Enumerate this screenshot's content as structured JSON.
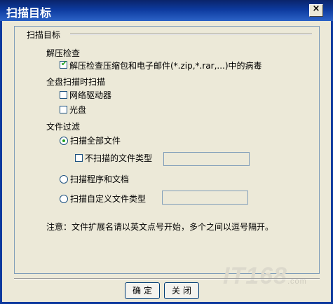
{
  "window": {
    "title": "扫描目标",
    "close_glyph": "×"
  },
  "group": {
    "title": "扫描目标"
  },
  "decompress": {
    "heading": "解压检查",
    "option_label": "解压检查压缩包和电子邮件(*.zip,*.rar,...)中的病毒",
    "checked": true
  },
  "full_scan": {
    "heading": "全盘扫描时扫描",
    "network_drive_label": "网络驱动器",
    "network_drive_checked": false,
    "cdrom_label": "光盘",
    "cdrom_checked": false
  },
  "file_filter": {
    "heading": "文件过滤",
    "scan_all_label": "扫描全部文件",
    "scan_all_selected": true,
    "exclude_types_label": "不扫描的文件类型",
    "exclude_types_checked": false,
    "exclude_types_value": "",
    "scan_programs_label": "扫描程序和文档",
    "scan_custom_label": "扫描自定义文件类型",
    "custom_types_value": ""
  },
  "note": "注意：文件扩展名请以英文点号开始，多个之间以逗号隔开。",
  "buttons": {
    "ok": "确定",
    "close": "关闭"
  },
  "watermark": {
    "main": "IT168",
    "sub": ".com"
  },
  "colors": {
    "title_bar": "#0d3a9e",
    "check_mark": "#21a121",
    "dialog_bg": "#ece9d8"
  }
}
